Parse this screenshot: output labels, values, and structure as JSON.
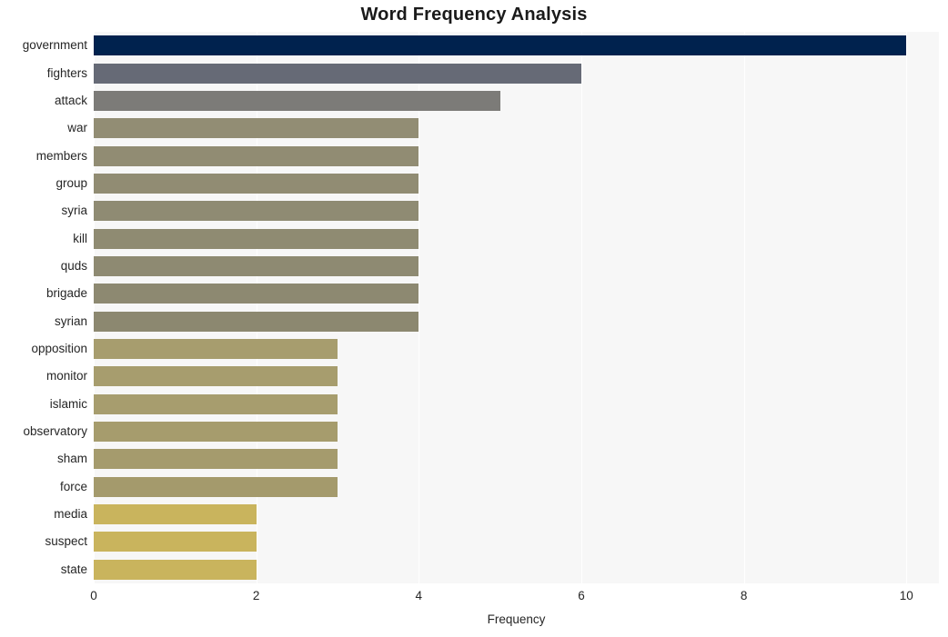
{
  "chart_data": {
    "type": "bar",
    "orientation": "horizontal",
    "title": "Word Frequency Analysis",
    "xlabel": "Frequency",
    "ylabel": "",
    "xlim": [
      0,
      10.4
    ],
    "xticks": [
      0,
      2,
      4,
      6,
      8,
      10
    ],
    "xtick_labels": [
      "0",
      "2",
      "4",
      "6",
      "8",
      "10"
    ],
    "grid": true,
    "grid_axis": "x",
    "legend": false,
    "plot_background": "#f7f7f7",
    "grid_color": "#ffffff",
    "categories": [
      "government",
      "fighters",
      "attack",
      "war",
      "members",
      "group",
      "syria",
      "kill",
      "quds",
      "brigade",
      "syrian",
      "opposition",
      "monitor",
      "islamic",
      "observatory",
      "sham",
      "force",
      "media",
      "suspect",
      "state"
    ],
    "values": [
      10,
      6,
      5,
      4,
      4,
      4,
      4,
      4,
      4,
      4,
      4,
      3,
      3,
      3,
      3,
      3,
      3,
      2,
      2,
      2
    ],
    "colors": [
      "#00224e",
      "#666a76",
      "#7c7b78",
      "#928d74",
      "#918c73",
      "#918c73",
      "#8f8b73",
      "#8f8b72",
      "#8e8a72",
      "#8d8971",
      "#8c8870",
      "#a79d6e",
      "#a79d6e",
      "#a79d6e",
      "#a69c6d",
      "#a59b6d",
      "#a49a6c",
      "#c9b45d",
      "#c9b45d",
      "#c9b45d"
    ]
  }
}
